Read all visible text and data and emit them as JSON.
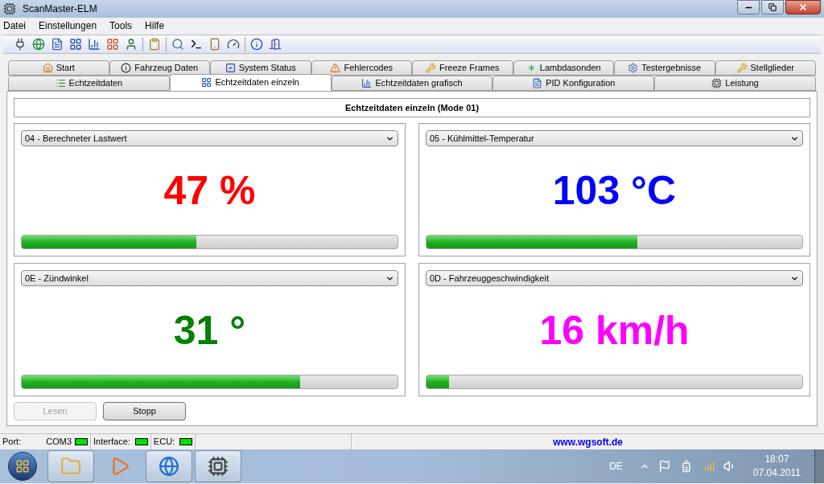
{
  "window": {
    "title": "ScanMaster-ELM"
  },
  "menu": [
    "Datei",
    "Einstellungen",
    "Tools",
    "Hilfe"
  ],
  "tab_rows": [
    [
      {
        "label": "Start",
        "selected": false
      },
      {
        "label": "Fahrzeug Daten",
        "selected": false
      },
      {
        "label": "System Status",
        "selected": false
      },
      {
        "label": "Fehlercodes",
        "selected": false
      },
      {
        "label": "Freeze Frames",
        "selected": false
      },
      {
        "label": "Lambdasonden",
        "selected": false
      },
      {
        "label": "Testergebnisse",
        "selected": false
      },
      {
        "label": "Stellglieder",
        "selected": false
      }
    ],
    [
      {
        "label": "Echtzeitdaten",
        "selected": false
      },
      {
        "label": "Echtzeitdaten einzeln",
        "selected": true
      },
      {
        "label": "Echtzeitdaten grafisch",
        "selected": false
      },
      {
        "label": "PID Konfiguration",
        "selected": false
      },
      {
        "label": "Leistung",
        "selected": false
      }
    ]
  ],
  "panel": {
    "title": "Echtzeitdaten einzeln (Mode 01)"
  },
  "gauges": [
    {
      "pid": "04 - Berechneter Lastwert",
      "value": "47 %",
      "color": "#ff0000",
      "level": 0.465
    },
    {
      "pid": "05 - Kühlmittel-Temperatur",
      "value": "103 °C",
      "color": "#0000ff",
      "level": 0.56
    },
    {
      "pid": "0E - Zündwinkel",
      "value": "31 °",
      "color": "#008000",
      "level": 0.74
    },
    {
      "pid": "0D - Fahrzeuggeschwindigkeit",
      "value": "16 km/h",
      "color": "#ff00ff",
      "level": 0.06
    }
  ],
  "buttons": [
    {
      "label": "Lesen",
      "disabled": true
    },
    {
      "label": "Stopp",
      "disabled": false
    }
  ],
  "status_bar": {
    "port_label": "Port:",
    "port": "COM3",
    "indicators": [
      {
        "label": "Interface:",
        "on": true
      },
      {
        "label": "ECU:",
        "on": true
      }
    ],
    "port_on": true,
    "link": "www.wgsoft.de"
  },
  "taskbar": {
    "language": "DE",
    "time": "18:07",
    "date": "07.04.2011"
  }
}
